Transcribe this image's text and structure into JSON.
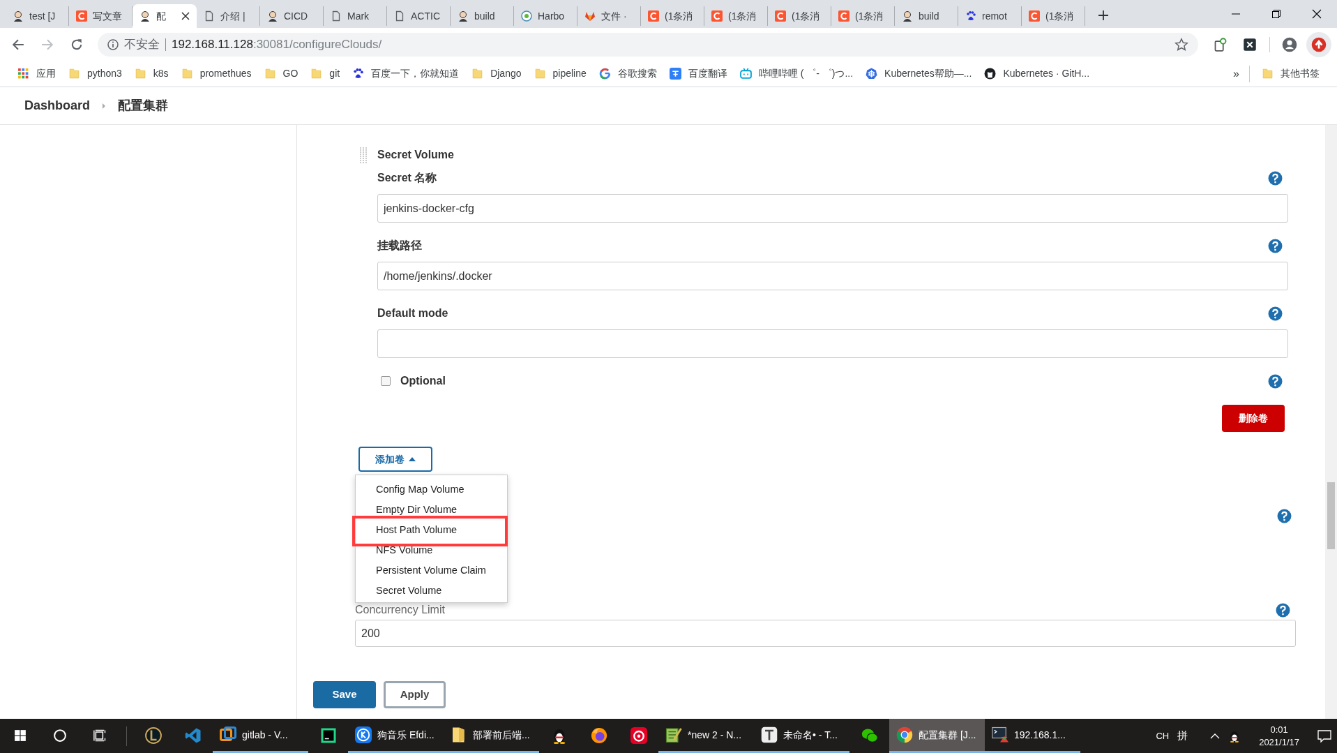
{
  "browser": {
    "tabs": [
      {
        "title": "test [J",
        "kind": "person",
        "selected": false
      },
      {
        "title": "写文章",
        "kind": "csdn",
        "selected": false
      },
      {
        "title": "配",
        "kind": "person",
        "selected": true
      },
      {
        "title": "介绍 |",
        "kind": "doc",
        "selected": false
      },
      {
        "title": "CICD",
        "kind": "person",
        "selected": false
      },
      {
        "title": "Mark",
        "kind": "doc",
        "selected": false
      },
      {
        "title": "ACTIC",
        "kind": "doc",
        "selected": false
      },
      {
        "title": "build",
        "kind": "person",
        "selected": false
      },
      {
        "title": "Harbo",
        "kind": "harbor",
        "selected": false
      },
      {
        "title": "文件 ·",
        "kind": "gitlab",
        "selected": false
      },
      {
        "title": "(1条消",
        "kind": "csdn",
        "selected": false
      },
      {
        "title": "(1条消",
        "kind": "csdn",
        "selected": false
      },
      {
        "title": "(1条消",
        "kind": "csdn",
        "selected": false
      },
      {
        "title": "(1条消",
        "kind": "csdn",
        "selected": false
      },
      {
        "title": "build",
        "kind": "person",
        "selected": false
      },
      {
        "title": "remot",
        "kind": "paw",
        "selected": false
      },
      {
        "title": "(1条消",
        "kind": "csdn",
        "selected": false
      }
    ],
    "address": {
      "security_label": "不安全",
      "host": "192.168.11.128",
      "path": ":30081/configureClouds/"
    },
    "bookmarks": [
      {
        "label": "应用",
        "kind": "apps"
      },
      {
        "label": "python3",
        "kind": "folder"
      },
      {
        "label": "k8s",
        "kind": "folder"
      },
      {
        "label": "promethues",
        "kind": "folder"
      },
      {
        "label": "GO",
        "kind": "folder"
      },
      {
        "label": "git",
        "kind": "folder"
      },
      {
        "label": "百度一下，你就知道",
        "kind": "paw"
      },
      {
        "label": "Django",
        "kind": "folder"
      },
      {
        "label": "pipeline",
        "kind": "folder"
      },
      {
        "label": "谷歌搜索",
        "kind": "google"
      },
      {
        "label": "百度翻译",
        "kind": "translate"
      },
      {
        "label": "哔哩哔哩 ( ゜- ゜)つ...",
        "kind": "tv"
      },
      {
        "label": "Kubernetes帮助—...",
        "kind": "wheel"
      },
      {
        "label": "Kubernetes · GitH...",
        "kind": "github"
      }
    ],
    "bookmarks_more": "»",
    "other_bookmarks": "其他书签"
  },
  "breadcrumb": [
    {
      "label": "Dashboard"
    },
    {
      "label": "配置集群"
    }
  ],
  "secret_volume": {
    "title": "Secret Volume",
    "fields": [
      {
        "label": "Secret 名称",
        "value": "jenkins-docker-cfg"
      },
      {
        "label": "挂载路径",
        "value": "/home/jenkins/.docker"
      },
      {
        "label": "Default mode"
      }
    ],
    "optional": {
      "label": "Optional",
      "checked": false
    },
    "delete_button": "删除卷"
  },
  "add_volume": {
    "label": "添加卷",
    "expanded": true,
    "items": [
      {
        "label": "Config Map Volume",
        "marked": false
      },
      {
        "label": "Empty Dir Volume",
        "marked": false
      },
      {
        "label": "Host Path Volume",
        "marked": true
      },
      {
        "label": "NFS Volume",
        "marked": false
      },
      {
        "label": "Persistent Volume Claim",
        "marked": false
      },
      {
        "label": "Secret Volume",
        "marked": false
      }
    ]
  },
  "concurrency_limit": {
    "label": "Concurrency Limit",
    "value": "200"
  },
  "actions": {
    "save": "Save",
    "apply": "Apply"
  },
  "taskbar": {
    "items": [
      {
        "kind": "start"
      },
      {
        "kind": "search"
      },
      {
        "kind": "taskview"
      },
      {
        "kind": "divider"
      },
      {
        "kind": "lol"
      },
      {
        "kind": "vscode"
      },
      {
        "kind": "vbox",
        "label": "gitlab - V...",
        "open": true,
        "active": false
      },
      {
        "kind": "pycharm"
      },
      {
        "kind": "kugou",
        "label": "狗音乐 Efdi...",
        "open": true,
        "active": false
      },
      {
        "kind": "folder",
        "label": "部署前后端...",
        "open": true,
        "active": false
      },
      {
        "kind": "penguin"
      },
      {
        "kind": "firefox"
      },
      {
        "kind": "netease"
      },
      {
        "kind": "notepad",
        "label": "*new 2 - N...",
        "open": true,
        "active": false
      },
      {
        "kind": "typora",
        "label": "未命名• - T...",
        "open": true,
        "active": false
      },
      {
        "kind": "chat"
      },
      {
        "kind": "chrome",
        "label": "配置集群 [J...",
        "open": true,
        "active": true
      },
      {
        "kind": "terminal",
        "label": "192.168.1...",
        "open": true,
        "active": false
      }
    ],
    "tray": {
      "language": "CH",
      "ime": "拼",
      "time": "0:01",
      "date": "2021/1/17"
    }
  }
}
